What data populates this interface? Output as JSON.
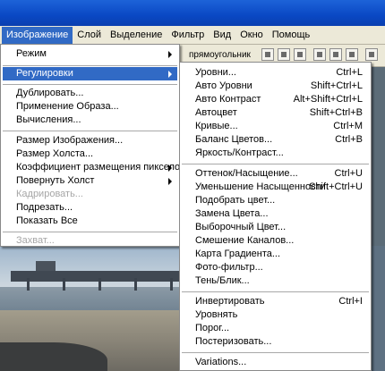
{
  "menubar": {
    "items": [
      "Изображение",
      "Слой",
      "Выделение",
      "Фильтр",
      "Вид",
      "Окно",
      "Помощь"
    ]
  },
  "options_bar": {
    "label": "прямоугольник"
  },
  "image_menu": {
    "items": [
      {
        "label": "Режим",
        "submenu": true
      },
      {
        "label": "Регулировки",
        "submenu": true,
        "highlighted": true
      },
      {
        "label": "Дублировать..."
      },
      {
        "label": "Применение Образа..."
      },
      {
        "label": "Вычисления..."
      },
      {
        "label": "Размер Изображения..."
      },
      {
        "label": "Размер Холста..."
      },
      {
        "label": "Коэффициент размещения пикселов",
        "submenu": true
      },
      {
        "label": "Повернуть Холст",
        "submenu": true
      },
      {
        "label": "Кадрировать...",
        "disabled": true
      },
      {
        "label": "Подрезать..."
      },
      {
        "label": "Показать Все"
      },
      {
        "label": "Захват...",
        "disabled": true
      }
    ]
  },
  "adjust_menu": {
    "items": [
      {
        "label": "Уровни...",
        "shortcut": "Ctrl+L"
      },
      {
        "label": "Авто Уровни",
        "shortcut": "Shift+Ctrl+L"
      },
      {
        "label": "Авто Контраст",
        "shortcut": "Alt+Shift+Ctrl+L"
      },
      {
        "label": "Автоцвет",
        "shortcut": "Shift+Ctrl+B"
      },
      {
        "label": "Кривые...",
        "shortcut": "Ctrl+M"
      },
      {
        "label": "Баланс Цветов...",
        "shortcut": "Ctrl+B"
      },
      {
        "label": "Яркость/Контраст...",
        "shortcut": ""
      },
      {
        "label": "Оттенок/Насыщение...",
        "shortcut": "Ctrl+U"
      },
      {
        "label": "Уменьшение Насыщенности",
        "shortcut": "Shift+Ctrl+U"
      },
      {
        "label": "Подобрать цвет...",
        "shortcut": ""
      },
      {
        "label": "Замена Цвета...",
        "shortcut": ""
      },
      {
        "label": "Выборочный Цвет...",
        "shortcut": ""
      },
      {
        "label": "Смешение Каналов...",
        "shortcut": ""
      },
      {
        "label": "Карта Градиента...",
        "shortcut": ""
      },
      {
        "label": "Фото-фильтр...",
        "shortcut": ""
      },
      {
        "label": "Тень/Блик...",
        "shortcut": ""
      },
      {
        "label": "Инвертировать",
        "shortcut": "Ctrl+I"
      },
      {
        "label": "Уровнять",
        "shortcut": ""
      },
      {
        "label": "Порог...",
        "shortcut": ""
      },
      {
        "label": "Постеризовать...",
        "shortcut": ""
      },
      {
        "label": "Variations...",
        "shortcut": ""
      }
    ]
  },
  "colors": {
    "highlight": "#316ac5",
    "menubar": "#ece9d8",
    "title": "#0a48c4"
  }
}
